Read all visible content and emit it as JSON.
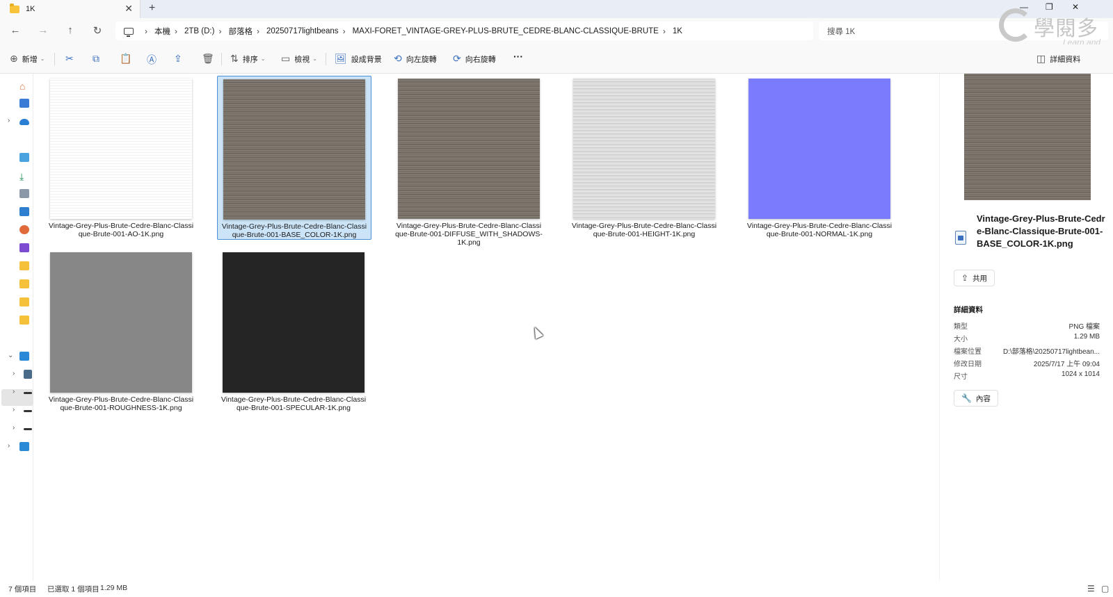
{
  "tab": {
    "title": "1K",
    "close": "✕",
    "new": "+"
  },
  "window": {
    "minimize": "—",
    "restore": "❐",
    "close": "✕"
  },
  "nav": {
    "back": "←",
    "forward": "→",
    "up": "↑",
    "refresh": "↻"
  },
  "breadcrumbs": [
    "本機",
    "2TB (D:)",
    "部落格",
    "20250717lightbeans",
    "MAXI-FORET_VINTAGE-GREY-PLUS-BRUTE_CEDRE-BLANC-CLASSIQUE-BRUTE",
    "1K"
  ],
  "search": {
    "placeholder": "搜尋 1K"
  },
  "watermark": {
    "text": "學閱多",
    "sub": "Learn and live"
  },
  "toolbar": {
    "new_label": "新增",
    "sort_label": "排序",
    "view_label": "檢視",
    "set_background": "設成背景",
    "rotate_left": "向左旋轉",
    "rotate_right": "向右旋轉",
    "more": "···",
    "details_label": "詳細資料"
  },
  "files": [
    {
      "name": "Vintage-Grey-Plus-Brute-Cedre-Blanc-Classique-Brute-001-AO-1K.png",
      "texture": "ao",
      "selected": false
    },
    {
      "name": "Vintage-Grey-Plus-Brute-Cedre-Blanc-Classique-Brute-001-BASE_COLOR-1K.png",
      "texture": "base",
      "selected": true
    },
    {
      "name": "Vintage-Grey-Plus-Brute-Cedre-Blanc-Classique-Brute-001-DIFFUSE_WITH_SHADOWS-1K.png",
      "texture": "base",
      "selected": false
    },
    {
      "name": "Vintage-Grey-Plus-Brute-Cedre-Blanc-Classique-Brute-001-HEIGHT-1K.png",
      "texture": "height",
      "selected": false
    },
    {
      "name": "Vintage-Grey-Plus-Brute-Cedre-Blanc-Classique-Brute-001-NORMAL-1K.png",
      "texture": "normal",
      "selected": false
    },
    {
      "name": "Vintage-Grey-Plus-Brute-Cedre-Blanc-Classique-Brute-001-ROUGHNESS-1K.png",
      "texture": "rough",
      "selected": false
    },
    {
      "name": "Vintage-Grey-Plus-Brute-Cedre-Blanc-Classique-Brute-001-SPECULAR-1K.png",
      "texture": "spec",
      "selected": false
    }
  ],
  "details": {
    "file_name": "Vintage-Grey-Plus-Brute-Cedre-Blanc-Classique-Brute-001-BASE_COLOR-1K.png",
    "share_label": "共用",
    "section_title": "詳細資料",
    "rows": [
      {
        "label": "類型",
        "value": "PNG 檔案"
      },
      {
        "label": "大小",
        "value": "1.29 MB"
      },
      {
        "label": "檔案位置",
        "value": "D:\\部落格\\20250717lightbean..."
      },
      {
        "label": "修改日期",
        "value": "2025/7/17 上午 09:04"
      },
      {
        "label": "尺寸",
        "value": "1024 x 1014"
      }
    ],
    "properties_label": "內容"
  },
  "status": {
    "items": "7 個項目",
    "selected": "已選取 1 個項目",
    "size": "1.29 MB"
  },
  "colors": {
    "selection_bg": "#cce4f7",
    "selection_border": "#4a8fd6",
    "normal_map": "#7b7bfd",
    "accent": "#3a6fbf"
  }
}
